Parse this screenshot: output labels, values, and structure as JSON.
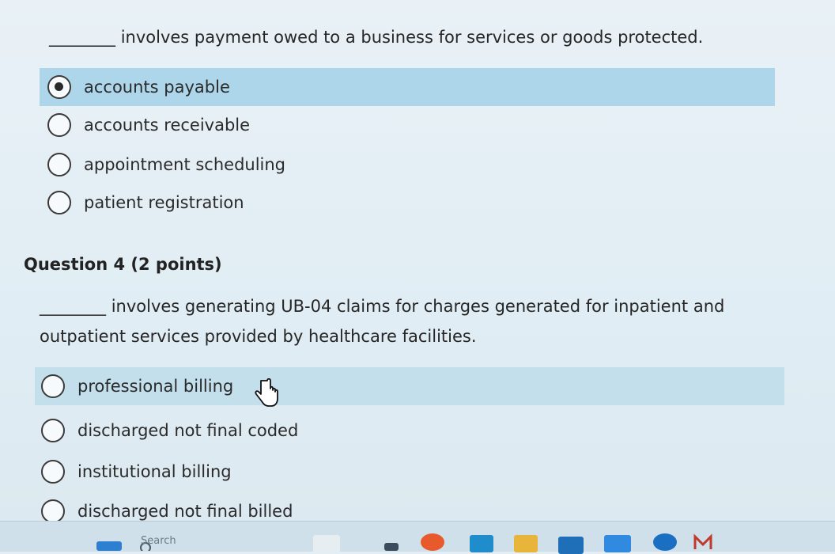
{
  "q3": {
    "blank": "________",
    "text": "involves payment owed to a business for services or goods protected.",
    "options": [
      {
        "label": "accounts payable",
        "selected": true
      },
      {
        "label": "accounts receivable",
        "selected": false
      },
      {
        "label": "appointment scheduling",
        "selected": false
      },
      {
        "label": "patient registration",
        "selected": false
      }
    ]
  },
  "q4": {
    "title": "Question 4 (2 points)",
    "blank": "________",
    "text_line1": "involves generating UB-04 claims for charges generated for inpatient and",
    "text_line2": "outpatient services provided by healthcare facilities.",
    "options": [
      {
        "label": "professional billing",
        "selected": false,
        "hovered": true
      },
      {
        "label": "discharged not final coded",
        "selected": false
      },
      {
        "label": "institutional billing",
        "selected": false
      },
      {
        "label": "discharged not final billed",
        "selected": false
      }
    ]
  },
  "taskbar": {
    "search_label": "Search",
    "colors": {
      "bar": "#cfe0ea",
      "accent_blue": "#2f7fd1",
      "accent_red": "#c0392b"
    }
  },
  "icons": [
    "radio-selected-icon",
    "radio-empty-icon",
    "hand-pointer-icon",
    "start-icon",
    "search-icon",
    "taskbar-app-icon"
  ]
}
